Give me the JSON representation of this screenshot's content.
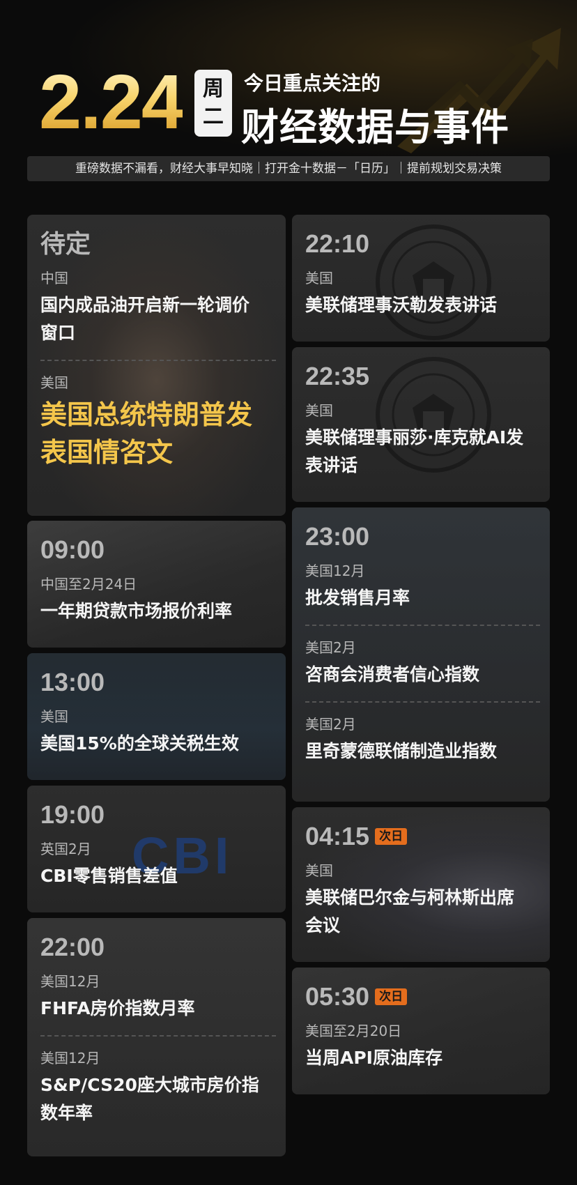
{
  "header": {
    "date": "2.24",
    "weekday_top": "周",
    "weekday_bottom": "二",
    "subtitle": "今日重点关注的",
    "title": "财经数据与事件",
    "tagline": "重磅数据不漏看，财经大事早知晓｜打开金十数据－「日历」｜提前规划交易决策"
  },
  "left_cards": [
    {
      "time": "待定",
      "items": [
        {
          "region": "中国",
          "event": "国内成品油开启新一轮调价窗口"
        },
        {
          "region": "美国",
          "event": "美国总统特朗普发表国情咨文"
        }
      ]
    },
    {
      "time": "09:00",
      "items": [
        {
          "region": "中国至2月24日",
          "event": "一年期贷款市场报价利率"
        }
      ]
    },
    {
      "time": "13:00",
      "items": [
        {
          "region": "美国",
          "event": "美国15%的全球关税生效"
        }
      ]
    },
    {
      "time": "19:00",
      "logo_text": "CBI",
      "items": [
        {
          "region": "英国2月",
          "event": "CBI零售销售差值"
        }
      ]
    },
    {
      "time": "22:00",
      "items": [
        {
          "region": "美国12月",
          "event": "FHFA房价指数月率"
        },
        {
          "region": "美国12月",
          "event": "S&P/CS20座大城市房价指数年率"
        }
      ]
    }
  ],
  "right_cards": [
    {
      "time": "22:10",
      "items": [
        {
          "region": "美国",
          "event": "美联储理事沃勒发表讲话"
        }
      ]
    },
    {
      "time": "22:35",
      "items": [
        {
          "region": "美国",
          "event": "美联储理事丽莎·库克就AI发表讲话"
        }
      ]
    },
    {
      "time": "23:00",
      "items": [
        {
          "region": "美国12月",
          "event": "批发销售月率"
        },
        {
          "region": "美国2月",
          "event": "咨商会消费者信心指数"
        },
        {
          "region": "美国2月",
          "event": "里奇蒙德联储制造业指数"
        }
      ]
    },
    {
      "time": "04:15",
      "badge": "次日",
      "items": [
        {
          "region": "美国",
          "event": "美联储巴尔金与柯林斯出席会议"
        }
      ]
    },
    {
      "time": "05:30",
      "badge": "次日",
      "items": [
        {
          "region": "美国至2月20日",
          "event": "当周API原油库存"
        }
      ]
    }
  ],
  "colors": {
    "background": "#0b0b0b",
    "card": "#2b2b2b",
    "gold": "#f4c64b",
    "badge": "#e46d1d",
    "time_gray": "#b9b9b9"
  },
  "icons": [
    "arrow-up-icon",
    "fed-seal-icon"
  ]
}
